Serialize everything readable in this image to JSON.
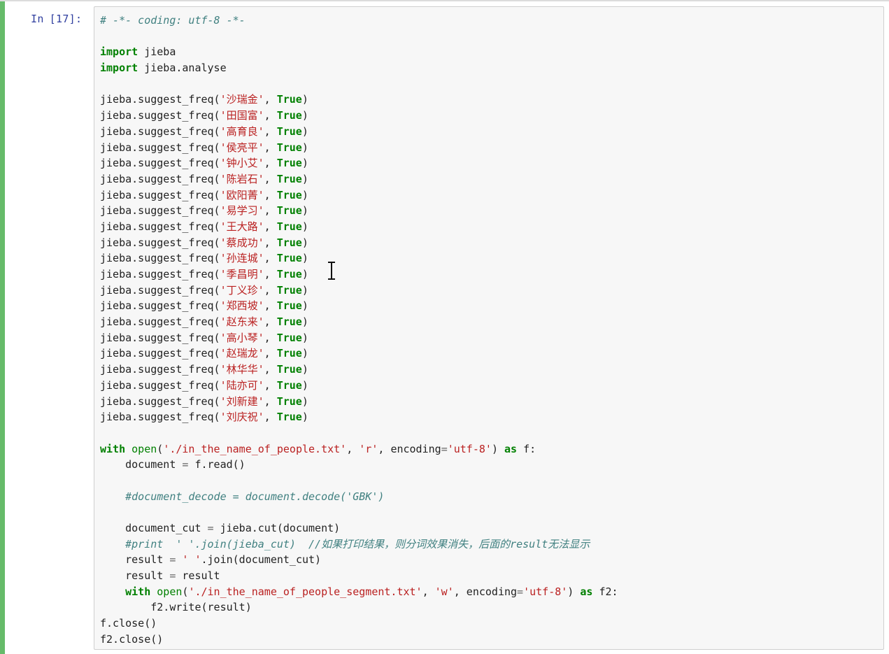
{
  "cell": {
    "prompt_label": "In",
    "execution_count": "[17]:"
  },
  "header_comment": "# -*- coding: utf-8 -*-",
  "imports": [
    {
      "keyword": "import",
      "module": "jieba"
    },
    {
      "keyword": "import",
      "module": "jieba.analyse"
    }
  ],
  "suggest_call_prefix": "jieba.suggest_freq(",
  "suggest_true": "True",
  "suggest_names": [
    "沙瑞金",
    "田国富",
    "高育良",
    "侯亮平",
    "钟小艾",
    "陈岩石",
    "欧阳菁",
    "易学习",
    "王大路",
    "蔡成功",
    "孙连城",
    "季昌明",
    "丁义珍",
    "郑西坡",
    "赵东来",
    "高小琴",
    "赵瑞龙",
    "林华华",
    "陆亦可",
    "刘新建",
    "刘庆祝"
  ],
  "with_block": {
    "with_kw": "with",
    "open_fn": "open",
    "file_in": "'./in_the_name_of_people.txt'",
    "mode_r": "'r'",
    "encoding_arg": "encoding",
    "encoding_val": "'utf-8'",
    "as_kw": "as",
    "handle": "f:",
    "read_line_var": "document",
    "read_line_expr": "f.read()",
    "decode_comment": "#document_decode = document.decode('GBK')",
    "cut_var": "document_cut",
    "cut_expr": "jieba.cut(document)",
    "print_comment": "#print  ' '.join(jieba_cut)  //如果打印结果，则分词效果消失，后面的result无法显示",
    "result_var": "result",
    "join_str": "' '",
    "join_expr": ".join(document_cut)",
    "result_assign_expr": "result",
    "file_out": "'./in_the_name_of_people_segment.txt'",
    "mode_w": "'w'",
    "handle2": "f2:",
    "write_line": "f2.write(result)"
  },
  "closing_lines": [
    "f.close()",
    "f2.close()"
  ]
}
